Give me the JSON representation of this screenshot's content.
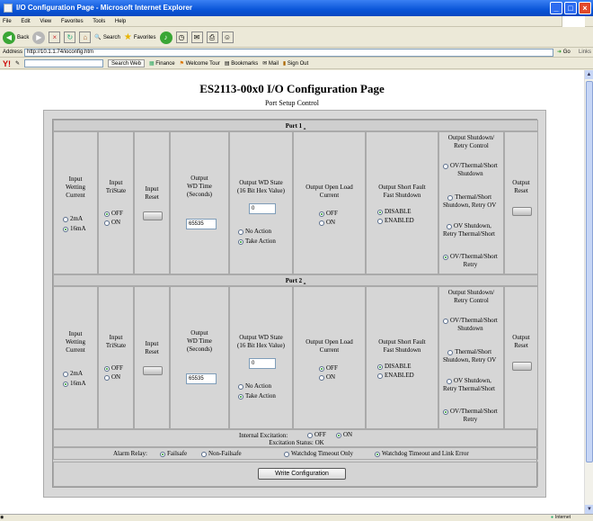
{
  "window": {
    "title": "I/O Configuration Page - Microsoft Internet Explorer",
    "menu": [
      "File",
      "Edit",
      "View",
      "Favorites",
      "Tools",
      "Help"
    ],
    "toolbar": {
      "back": "Back",
      "search": "Search",
      "favorites": "Favorites"
    },
    "address_label": "Address",
    "address": "http://10.1.1.74/ioconfig.htm",
    "go": "Go",
    "links": "Links",
    "yahoo": {
      "logo": "Y!",
      "search_web": "Search Web",
      "finance": "Finance",
      "welcome_tour": "Welcome Tour",
      "bookmarks": "Bookmarks",
      "mail": "Mail",
      "sign_out": "Sign Out"
    },
    "status_zone": "Internet"
  },
  "page": {
    "title": "ES2113-00x0 I/O Configuration Page",
    "subtitle": "Port Setup Control",
    "columns": {
      "wetting": [
        "Input",
        "Wetting",
        "Current"
      ],
      "tristate": [
        "Input",
        "TriState"
      ],
      "reset": [
        "Input",
        "Reset"
      ],
      "wd_time": [
        "Output",
        "WD Time",
        "(Seconds)"
      ],
      "wd_state": [
        "Output WD State",
        "(16 Bit Hex Value)"
      ],
      "open_load": [
        "Output Open Load",
        "Current"
      ],
      "short_fault": [
        "Output Short Fault",
        "Fast Shutdown"
      ],
      "shutdown": [
        "Output Shutdown/",
        "Retry Control"
      ],
      "out_reset": [
        "Output",
        "Reset"
      ]
    },
    "options": {
      "wetting": [
        "2mA",
        "16mA"
      ],
      "tristate": [
        "OFF",
        "ON"
      ],
      "wd_action": [
        "No Action",
        "Take Action"
      ],
      "open_load": [
        "OFF",
        "ON"
      ],
      "short_fault": [
        "DISABLE",
        "ENABLED"
      ],
      "shutdown": [
        [
          "OV/Thermal/Short",
          "Shutdown"
        ],
        [
          "Thermal/Short",
          "Shutdown, Retry OV"
        ],
        [
          "OV Shutdown,",
          "Retry Thermal/Short"
        ],
        [
          "OV/Thermal/Short",
          "Retry"
        ]
      ]
    },
    "ports": [
      {
        "header": "Port 1",
        "wetting": "16mA",
        "tristate": "OFF",
        "wd_time": "65535",
        "wd_state": "0",
        "wd_action": "Take Action",
        "open_load": "OFF",
        "short_fault": "DISABLE",
        "shutdown": 3
      },
      {
        "header": "Port 2",
        "wetting": "16mA",
        "tristate": "OFF",
        "wd_time": "65535",
        "wd_state": "0",
        "wd_action": "Take Action",
        "open_load": "OFF",
        "short_fault": "DISABLE",
        "shutdown": 3
      }
    ],
    "excitation": {
      "label": "Internal Excitation:",
      "off": "OFF",
      "on": "ON",
      "selected": "ON",
      "status": "Excitation Status: OK"
    },
    "alarm": {
      "label": "Alarm Relay:",
      "failsafe": "Failsafe",
      "non_failsafe": "Non-Failsafe",
      "wd_only": "Watchdog Timeout Only",
      "wd_link": "Watchdog Timeout and Link Error",
      "mode": "Failsafe",
      "trigger": "Watchdog Timeout and Link Error"
    },
    "write_button": "Write Configuration"
  }
}
